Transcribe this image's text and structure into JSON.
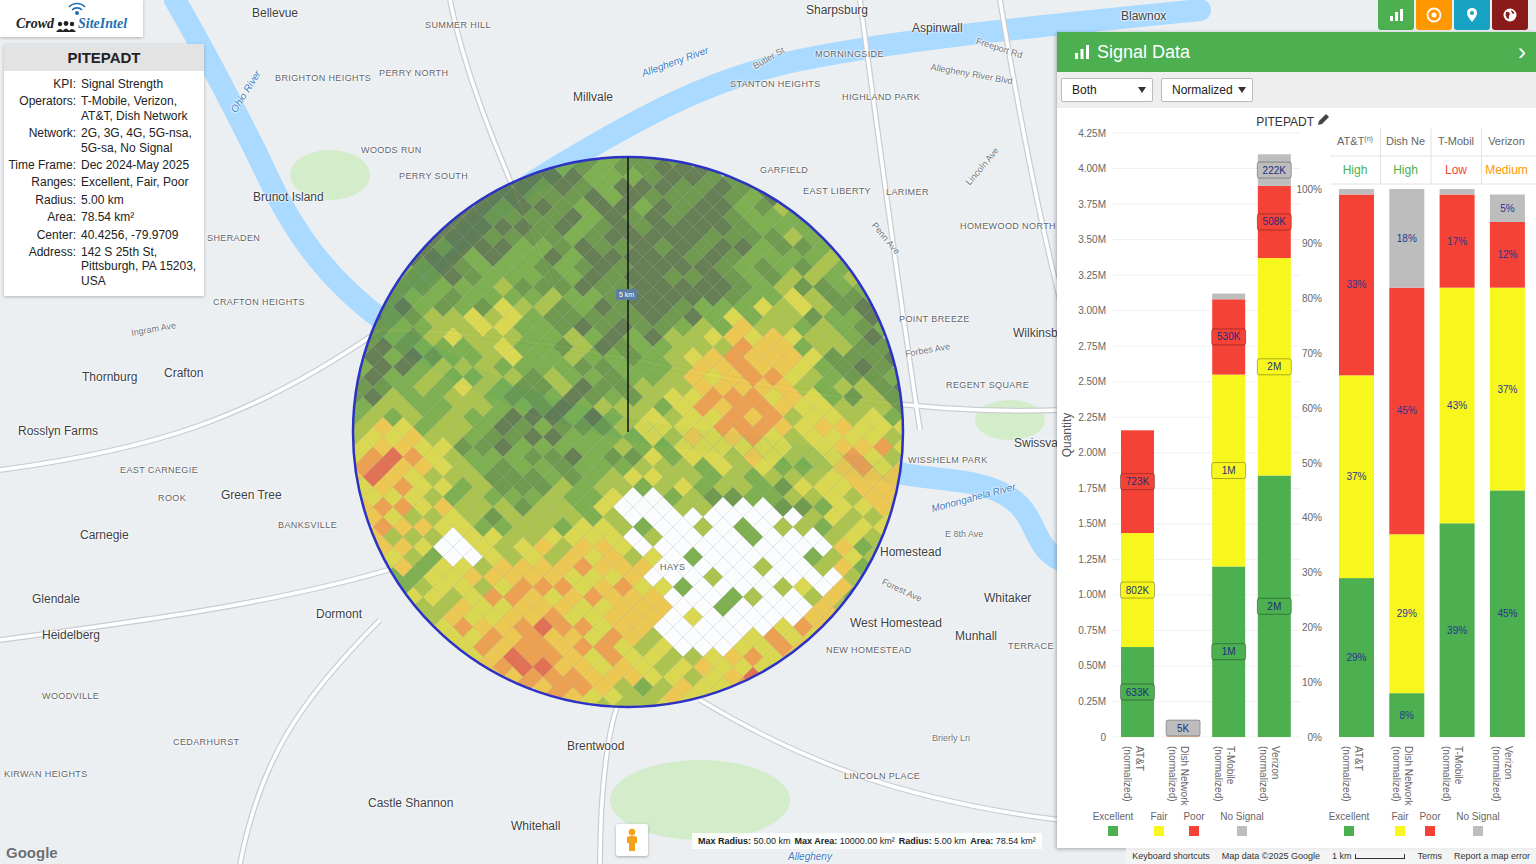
{
  "logo": {
    "name_left": "Crowd",
    "name_right": "SiteIntel"
  },
  "info_panel": {
    "title": "PITEPADT",
    "rows": [
      {
        "label": "KPI:",
        "value": "Signal Strength"
      },
      {
        "label": "Operators:",
        "value": "T-Mobile, Verizon, AT&T, Dish Network"
      },
      {
        "label": "Network:",
        "value": "2G, 3G, 4G, 5G-nsa, 5G-sa, No Signal"
      },
      {
        "label": "Time Frame:",
        "value": "Dec 2024-May 2025"
      },
      {
        "label": "Ranges:",
        "value": "Excellent, Fair, Poor"
      },
      {
        "label": "Radius:",
        "value": "5.00 km"
      },
      {
        "label": "Area:",
        "value": "78.54 km²"
      },
      {
        "label": "Center:",
        "value": "40.4256, -79.9709"
      },
      {
        "label": "Address:",
        "value": "142 S 25th St, Pittsburgh, PA 15203, USA"
      }
    ]
  },
  "toolbar": [
    {
      "color": "#4caf50"
    },
    {
      "color": "#ff9800"
    },
    {
      "color": "#17a2c4"
    },
    {
      "color": "#8b1a1a"
    }
  ],
  "map": {
    "circle_label": "5 km",
    "google_logo": "Google",
    "labels": [
      {
        "text": "Bellevue",
        "kind": "town"
      },
      {
        "text": "SUMMER HILL",
        "kind": "district"
      },
      {
        "text": "Sharpsburg",
        "kind": "town"
      },
      {
        "text": "Aspinwall",
        "kind": "town"
      },
      {
        "text": "Blawnox",
        "kind": "town"
      },
      {
        "text": "BRIGHTON HEIGHTS",
        "kind": "district"
      },
      {
        "text": "PERRY NORTH",
        "kind": "district"
      },
      {
        "text": "Millvale",
        "kind": "town"
      },
      {
        "text": "MORNINGSIDE",
        "kind": "district"
      },
      {
        "text": "STANTON HEIGHTS",
        "kind": "district"
      },
      {
        "text": "HIGHLAND PARK",
        "kind": "district"
      },
      {
        "text": "WOODS RUN",
        "kind": "district"
      },
      {
        "text": "PERRY SOUTH",
        "kind": "district"
      },
      {
        "text": "GARFIELD",
        "kind": "district"
      },
      {
        "text": "EAST LIBERTY",
        "kind": "district"
      },
      {
        "text": "LARIMER",
        "kind": "district"
      },
      {
        "text": "HOMEWOOD NORTH",
        "kind": "district"
      },
      {
        "text": "Brunot Island",
        "kind": "town"
      },
      {
        "text": "SHERADEN",
        "kind": "district"
      },
      {
        "text": "CRAFTON HEIGHTS",
        "kind": "district"
      },
      {
        "text": "POINT BREEZE",
        "kind": "district"
      },
      {
        "text": "Wilkinsb",
        "kind": "town"
      },
      {
        "text": "REGENT SQUARE",
        "kind": "district"
      },
      {
        "text": "Swissva",
        "kind": "town"
      },
      {
        "text": "Thornburg",
        "kind": "town"
      },
      {
        "text": "Crafton",
        "kind": "town"
      },
      {
        "text": "Rosslyn Farms",
        "kind": "town"
      },
      {
        "text": "EAST CARNEGIE",
        "kind": "district"
      },
      {
        "text": "ROOK",
        "kind": "district"
      },
      {
        "text": "Green Tree",
        "kind": "town"
      },
      {
        "text": "WISSHELM PARK",
        "kind": "district"
      },
      {
        "text": "BANKSVILLE",
        "kind": "district"
      },
      {
        "text": "Carnegie",
        "kind": "town"
      },
      {
        "text": "Homestead",
        "kind": "town"
      },
      {
        "text": "Glendale",
        "kind": "town"
      },
      {
        "text": "Dormont",
        "kind": "town"
      },
      {
        "text": "Whitaker",
        "kind": "town"
      },
      {
        "text": "West Homestead",
        "kind": "town"
      },
      {
        "text": "Munhall",
        "kind": "town"
      },
      {
        "text": "Heidelberg",
        "kind": "town"
      },
      {
        "text": "NEW HOMESTEAD",
        "kind": "district"
      },
      {
        "text": "TERRACE",
        "kind": "district"
      },
      {
        "text": "HAYS",
        "kind": "district"
      },
      {
        "text": "WOODVILLE",
        "kind": "district"
      },
      {
        "text": "CEDARHURST",
        "kind": "district"
      },
      {
        "text": "Brentwood",
        "kind": "town"
      },
      {
        "text": "LINCOLN PLACE",
        "kind": "district"
      },
      {
        "text": "Castle Shannon",
        "kind": "town"
      },
      {
        "text": "Whitehall",
        "kind": "town"
      },
      {
        "text": "KIRWAN HEIGHTS",
        "kind": "district"
      },
      {
        "text": "Ohio River",
        "kind": "water"
      },
      {
        "text": "Allegheny River",
        "kind": "water"
      },
      {
        "text": "Monongahela River",
        "kind": "water"
      },
      {
        "text": "Allegheny",
        "kind": "water"
      },
      {
        "text": "Freeport Rd",
        "kind": "road"
      },
      {
        "text": "Allegheny River Blvd",
        "kind": "road"
      },
      {
        "text": "Butler St",
        "kind": "road"
      },
      {
        "text": "Penn Ave",
        "kind": "road"
      },
      {
        "text": "Forbes Ave",
        "kind": "road"
      },
      {
        "text": "Ingram Ave",
        "kind": "road"
      },
      {
        "text": "Forest Ave",
        "kind": "road"
      },
      {
        "text": "E 8th Ave",
        "kind": "road"
      },
      {
        "text": "Lincoln Ave",
        "kind": "road"
      },
      {
        "text": "Brierly Ln",
        "kind": "road"
      }
    ]
  },
  "map_status": [
    {
      "label": "Max Radius:",
      "value": "50.00 km"
    },
    {
      "label": "Max Area:",
      "value": "10000.00 km²"
    },
    {
      "label": "Radius:",
      "value": "5.00 km"
    },
    {
      "label": "Area:",
      "value": "78.54 km²"
    }
  ],
  "attribution": {
    "items": [
      "Keyboard shortcuts",
      "Map data ©2025 Google"
    ],
    "scale": "1 km",
    "links": [
      "Terms",
      "Report a map error"
    ]
  },
  "panel": {
    "title": "Signal Data",
    "collapse_icon": "›",
    "controls": [
      {
        "value": "Both"
      },
      {
        "value": "Normalized"
      }
    ],
    "quantity_chart": {
      "title": "PITEPADT",
      "axis_title": "Quantity",
      "max": 4.25,
      "ticks": [
        "4.25M",
        "4.00M",
        "3.75M",
        "3.50M",
        "3.25M",
        "3.00M",
        "2.75M",
        "2.50M",
        "2.25M",
        "2.00M",
        "1.75M",
        "1.50M",
        "1.25M",
        "1.00M",
        "0.75M",
        "0.50M",
        "0.25M",
        "0"
      ],
      "bars": [
        {
          "name": "AT&T",
          "suffix": "(normalized)",
          "segments": [
            {
              "value": 0.633,
              "label": "633K"
            },
            {
              "value": 0.802,
              "label": "802K"
            },
            {
              "value": 0.723,
              "label": "723K"
            },
            {
              "value": 0.0
            }
          ]
        },
        {
          "name": "Dish Network",
          "suffix": "(normalized)",
          "segments": [
            {
              "value": 0.0004
            },
            {
              "value": 0.00145
            },
            {
              "value": 0.00225
            },
            {
              "value": 0.0009,
              "label": "5K"
            }
          ]
        },
        {
          "name": "T-Mobile",
          "suffix": "(normalized)",
          "segments": [
            {
              "value": 1.2,
              "label": "1M"
            },
            {
              "value": 1.35,
              "label": "1M"
            },
            {
              "value": 0.53,
              "label": "530K"
            },
            {
              "value": 0.04
            }
          ]
        },
        {
          "name": "Verizon",
          "suffix": "(normalized)",
          "segments": [
            {
              "value": 1.84,
              "label": "2M"
            },
            {
              "value": 1.53,
              "label": "2M"
            },
            {
              "value": 0.508,
              "label": "508K"
            },
            {
              "value": 0.222,
              "label": "222K"
            }
          ]
        }
      ],
      "legend": [
        {
          "label": "Excellent",
          "color": "#4caf50"
        },
        {
          "label": "Fair",
          "color": "#f7f71e"
        },
        {
          "label": "Poor",
          "color": "#f44336"
        },
        {
          "label": "No Signal",
          "color": "#bdbdbd"
        }
      ]
    },
    "percent_chart": {
      "max": 100,
      "columns": [
        {
          "name": "AT&T",
          "sup": "(n)",
          "rating": "High",
          "rating_color": "#4caf50"
        },
        {
          "name": "Dish Ne",
          "rating": "High",
          "rating_color": "#4caf50"
        },
        {
          "name": "T-Mobil",
          "rating": "Low",
          "rating_color": "#f44336"
        },
        {
          "name": "Verizon",
          "rating": "Medium",
          "rating_color": "#ff9800"
        }
      ],
      "ticks": [
        "100%",
        "90%",
        "80%",
        "70%",
        "60%",
        "50%",
        "40%",
        "30%",
        "20%",
        "10%",
        "0%"
      ],
      "bars": [
        {
          "name": "AT&T",
          "suffix": "(normalized)",
          "segments": [
            {
              "value": 29,
              "label": "29%"
            },
            {
              "value": 37,
              "label": "37%"
            },
            {
              "value": 33,
              "label": "33%"
            },
            {
              "value": 1
            }
          ]
        },
        {
          "name": "Dish Network",
          "suffix": "(normalized)",
          "segments": [
            {
              "value": 8,
              "label": "8%"
            },
            {
              "value": 29,
              "label": "29%"
            },
            {
              "value": 45,
              "label": "45%"
            },
            {
              "value": 18,
              "label": "18%"
            }
          ]
        },
        {
          "name": "T-Mobile",
          "suffix": "(normalized)",
          "segments": [
            {
              "value": 39,
              "label": "39%"
            },
            {
              "value": 43,
              "label": "43%"
            },
            {
              "value": 17,
              "label": "17%"
            },
            {
              "value": 1
            }
          ]
        },
        {
          "name": "Verizon",
          "suffix": "(normalized)",
          "segments": [
            {
              "value": 45,
              "label": "45%"
            },
            {
              "value": 37,
              "label": "37%"
            },
            {
              "value": 12,
              "label": "12%"
            },
            {
              "value": 5,
              "label": "5%"
            }
          ]
        }
      ],
      "legend": [
        {
          "label": "Excellent",
          "color": "#4caf50"
        },
        {
          "label": "Fair",
          "color": "#f7f71e"
        },
        {
          "label": "Poor",
          "color": "#f44336"
        },
        {
          "label": "No Signal",
          "color": "#bdbdbd"
        }
      ]
    }
  }
}
